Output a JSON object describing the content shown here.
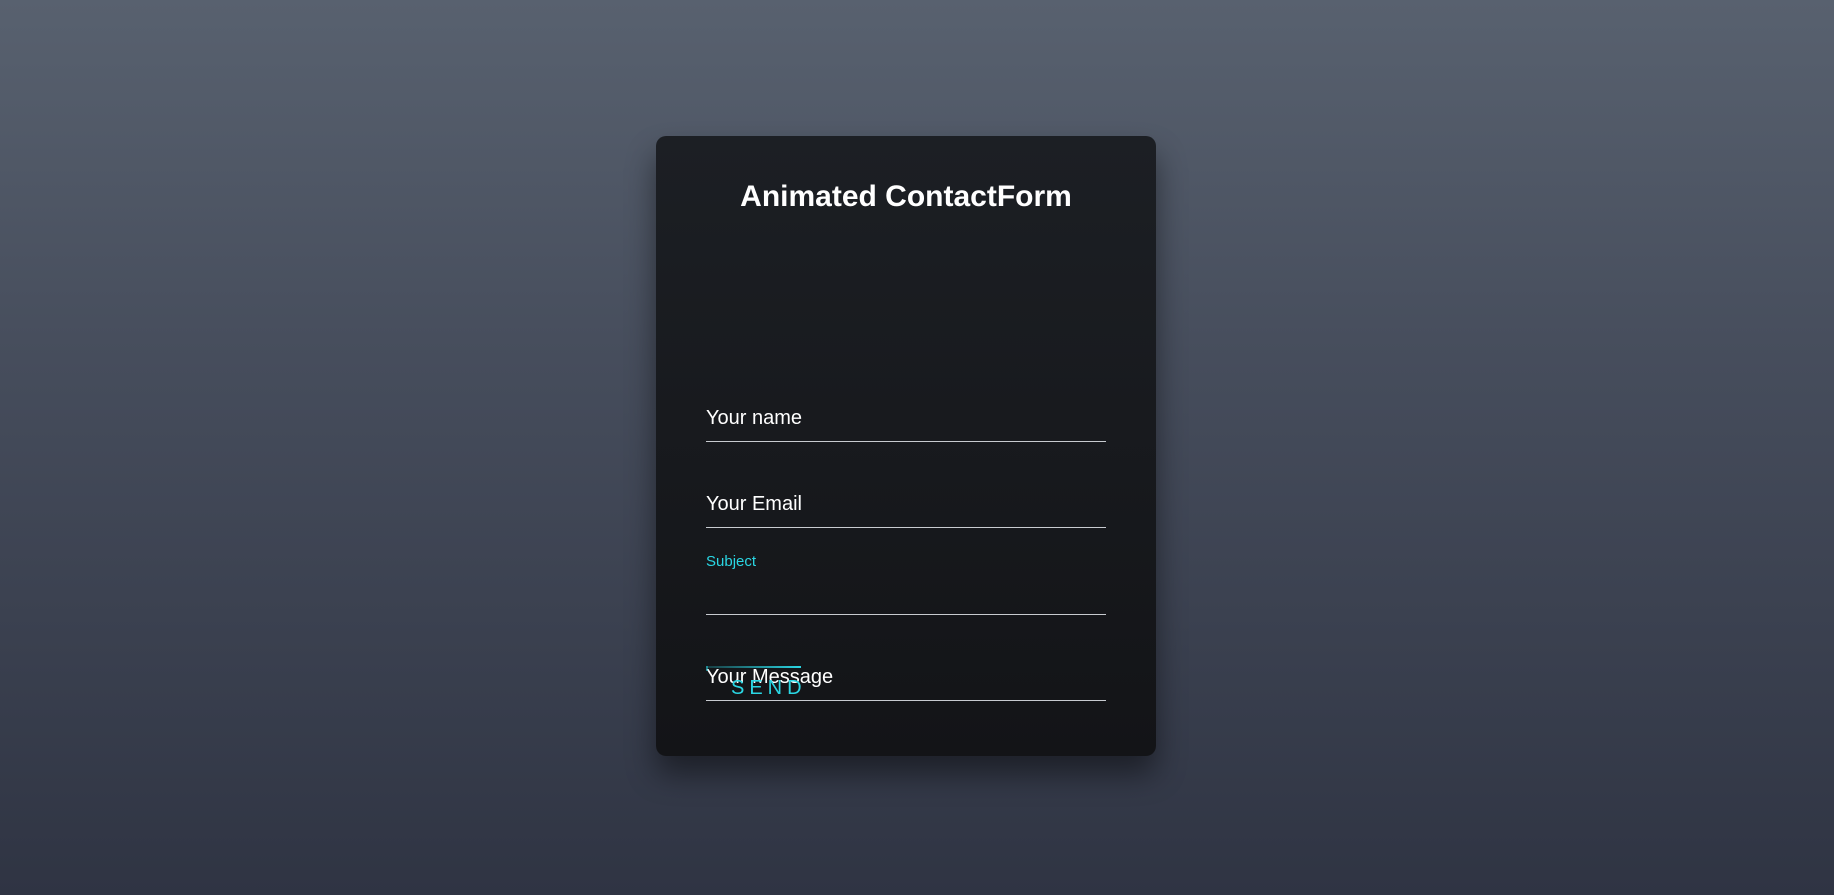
{
  "form": {
    "title": "Animated ContactForm",
    "fields": {
      "name": {
        "label": "Your name",
        "value": ""
      },
      "email": {
        "label": "Your Email",
        "value": ""
      },
      "subject": {
        "label": "Subject",
        "value": ""
      },
      "message": {
        "label": "Your Message",
        "value": ""
      }
    },
    "submit_label": "SEND"
  },
  "colors": {
    "accent": "#2ad6e3",
    "card": "#17191d",
    "text": "#ffffff",
    "underline": "#c8cbd0"
  }
}
